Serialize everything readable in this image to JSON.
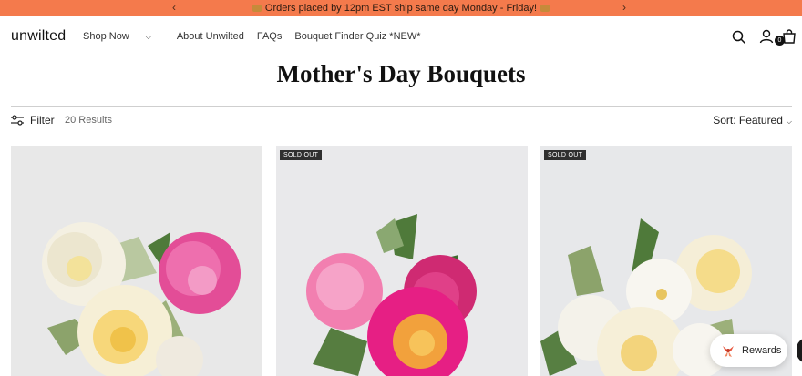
{
  "announcement": {
    "text": "Orders placed by 12pm EST ship same day Monday - Friday!",
    "prev_icon": "chevron-left-icon",
    "next_icon": "chevron-right-icon",
    "prev_glyph": "‹",
    "next_glyph": "›",
    "background": "#f47a4c"
  },
  "header": {
    "logo": "unwilted",
    "nav": [
      {
        "label": "Shop Now",
        "has_dropdown": true
      },
      {
        "label": "About Unwilted"
      },
      {
        "label": "FAQs"
      },
      {
        "label": "Bouquet Finder Quiz *NEW*"
      }
    ],
    "icons": [
      "search-icon",
      "account-icon",
      "cart-icon"
    ],
    "cart_count": "0"
  },
  "page": {
    "title": "Mother's Day Bouquets"
  },
  "toolbar": {
    "filter_label": "Filter",
    "results": "20 Results",
    "sort_label": "Sort: Featured"
  },
  "products": [
    {
      "sold_out": false,
      "badge": ""
    },
    {
      "sold_out": true,
      "badge": "SOLD OUT"
    },
    {
      "sold_out": true,
      "badge": "SOLD OUT"
    }
  ],
  "rewards": {
    "label": "Rewards",
    "icon": "gift-ribbon-icon"
  }
}
